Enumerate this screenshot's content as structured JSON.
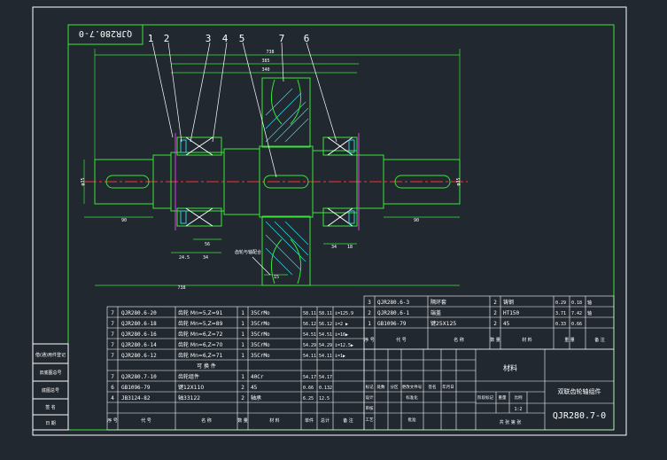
{
  "drawing_number": "QJR280.7-0",
  "drawing_number_rotated": "QJR280.7-0",
  "balloons": [
    "1",
    "2",
    "3",
    "4",
    "5",
    "7",
    "6"
  ],
  "dimensions": {
    "top1": "738",
    "top2": "385",
    "top3": "340",
    "left_len": "90",
    "right_len": "90",
    "bottom_total": "738",
    "d1": "24.5",
    "d2": "34",
    "d3": "56",
    "d4": "34",
    "gap": "18",
    "small": "15",
    "shaft_dia_left": "φ35",
    "shaft_dia_right": "φ35"
  },
  "leader_note": "齿轮与轴配合",
  "gear_table": {
    "rows": [
      {
        "qty": "7",
        "code": "QJR280.6-20",
        "name": "齿轮 Mn=5,Z=91",
        "n": "1",
        "mat": "35CrMo",
        "w1": "58.11",
        "w2": "58.11",
        "note": "i=125.9"
      },
      {
        "qty": "7",
        "code": "QJR280.6-18",
        "name": "齿轮 Mn=5,Z=89",
        "n": "1",
        "mat": "35CrMo",
        "w1": "56.12",
        "w2": "56.12",
        "note": "i=2 ▶"
      },
      {
        "qty": "7",
        "code": "QJR280.6-16",
        "name": "齿轮 Mn=6,Z=72",
        "n": "1",
        "mat": "35CrMo",
        "w1": "54.51",
        "w2": "54.51",
        "note": "i=16▶"
      },
      {
        "qty": "7",
        "code": "QJR280.6-14",
        "name": "齿轮 Mn=6,Z=70",
        "n": "1",
        "mat": "35CrMo",
        "w1": "54.29",
        "w2": "54.29",
        "note": "i=12.5▶"
      },
      {
        "qty": "7",
        "code": "QJR280.6-12",
        "name": "齿轮 Mn=6,Z=71",
        "n": "1",
        "mat": "35CrMo",
        "w1": "54.11",
        "w2": "54.11",
        "note": "i=1▶"
      }
    ],
    "section_label": "可 换 件",
    "lower": [
      {
        "qty": "7",
        "code": "QJR280.7-10",
        "name": "齿轮组件",
        "n": "1",
        "mat": "40Cr",
        "w1": "54.17",
        "w2": "54.17"
      },
      {
        "qty": "6",
        "code": "GB1096-79",
        "name": "键12X110",
        "n": "2",
        "mat": "45",
        "w1": "0.66",
        "w2": "0.132"
      },
      {
        "qty": "4",
        "code": "JB3124-82",
        "name": "轴33122",
        "n": "2",
        "mat": "轴承",
        "w1": "6.25",
        "w2": "12.5"
      }
    ],
    "header": [
      "序 号",
      "代 号",
      "名 称",
      "数 量",
      "材 料",
      "单件",
      "总计",
      "备 注"
    ]
  },
  "right_table": {
    "rows": [
      {
        "qty": "3",
        "code": "QJR280.6-3",
        "name": "隔环套",
        "n": "2",
        "mat": "铸钢",
        "w1": "0.29",
        "w2": "0.18",
        "note": "轴"
      },
      {
        "qty": "2",
        "code": "QJR280.6-1",
        "name": "端盖",
        "n": "2",
        "mat": "HT150",
        "w1": "3.71",
        "w2": "7.42",
        "note": "轴"
      },
      {
        "qty": "1",
        "code": "GB1096-79",
        "name": "键25X125",
        "n": "2",
        "mat": "45",
        "w1": "0.33",
        "w2": "0.66",
        "note": ""
      }
    ],
    "header": [
      "序 号",
      "代 号",
      "名 称",
      "数 量",
      "材 料",
      "重 量",
      "备 注"
    ]
  },
  "title_block": {
    "material": "材料",
    "part_name": "双联齿轮轴组件",
    "number": "QJR280.7-0",
    "scale_label": "1:2",
    "sheet": "共 张 第 张",
    "cells": [
      "标记",
      "处数",
      "分区",
      "更改文件号",
      "签名",
      "年月日",
      "设计",
      "标准化",
      "审核",
      "工艺",
      "批准",
      "阶段标记",
      "重量",
      "比例"
    ]
  },
  "side_labels": [
    "借(通)用件登记",
    "旧底图总号",
    "底图总号",
    "签 名",
    "日 期"
  ]
}
